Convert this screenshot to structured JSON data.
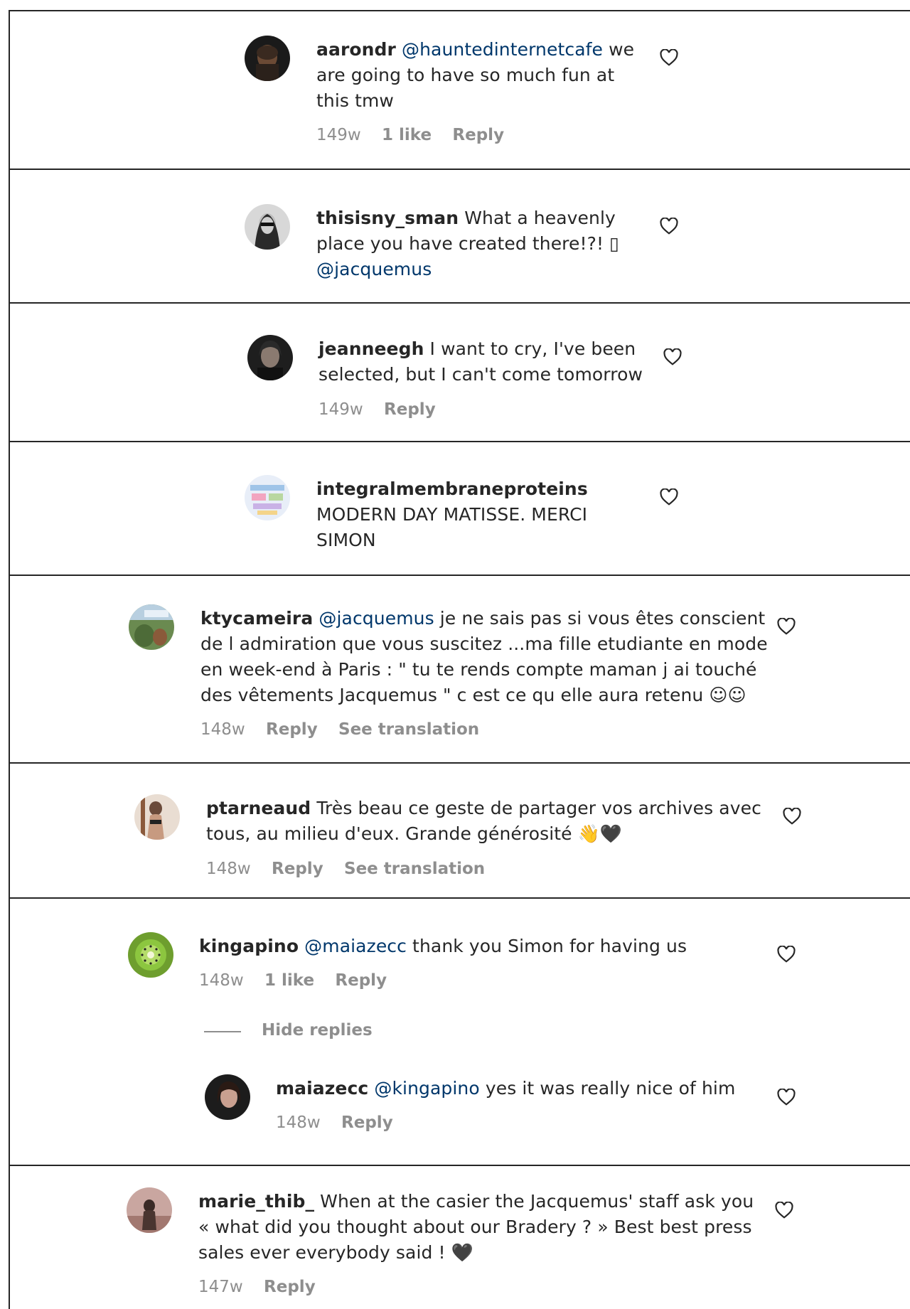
{
  "comments": [
    {
      "username": "aarondr",
      "mention": "@hauntedinternetcafe",
      "text_lines": [
        "we",
        "are going to have so much fun at",
        "this tmw"
      ],
      "time": "149w",
      "likes": "1 like",
      "reply": "Reply"
    },
    {
      "username": "thisisny_sman",
      "text_lines": [
        "What a heavenly",
        "place you have created there!?! ▯",
        "@jacquemus"
      ]
    },
    {
      "username": "jeanneegh",
      "text_lines": [
        "I want to cry, I've been",
        "selected, but I can't come tomorrow"
      ],
      "time": "149w",
      "reply": "Reply"
    },
    {
      "username": "integralmembraneproteins",
      "text_lines": [
        "MODERN DAY MATISSE. MERCI",
        "SIMON"
      ]
    },
    {
      "username": "ktycameira",
      "mention": "@jacquemus",
      "text_lines": [
        "je ne sais pas si vous êtes conscient",
        "de l admiration que vous suscitez ...ma fille etudiante en mode",
        "en week-end à Paris : \" tu te rends compte maman j ai touché",
        "des vêtements Jacquemus \" c est ce qu elle aura retenu ☺☺"
      ],
      "time": "148w",
      "reply": "Reply",
      "translate": "See translation"
    },
    {
      "username": "ptarneaud",
      "text_lines": [
        "Très beau ce geste de partager vos archives avec",
        "tous, au milieu d'eux. Grande générosité 👋🖤"
      ],
      "time": "148w",
      "reply": "Reply",
      "translate": "See translation"
    },
    {
      "username": "kingapino",
      "mention": "@maiazecc",
      "text_lines": [
        "thank you Simon for having us"
      ],
      "time": "148w",
      "likes": "1 like",
      "reply": "Reply",
      "hide_replies": "Hide replies",
      "reply_item": {
        "username": "maiazecc",
        "mention": "@kingapino",
        "text": "yes it was really nice of him",
        "time": "148w",
        "reply": "Reply"
      }
    },
    {
      "username": "marie_thib_",
      "text_lines": [
        "When at the casier the Jacquemus' staff ask you",
        "« what did you thought about our Bradery ? » Best best press",
        "sales ever everybody said ! 🖤"
      ],
      "time": "147w",
      "reply": "Reply"
    }
  ],
  "icons": {
    "like": "heart-outline-icon",
    "avatar": "user-avatar"
  }
}
